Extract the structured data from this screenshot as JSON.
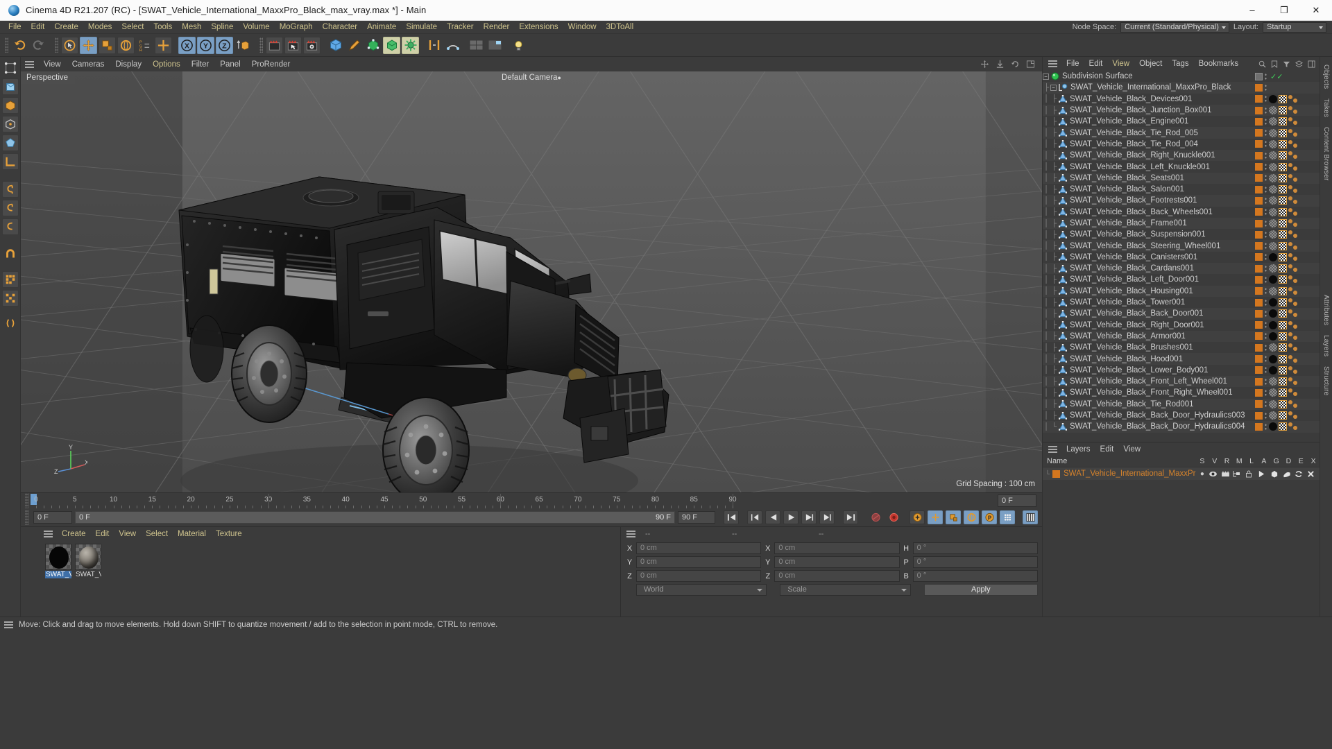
{
  "window": {
    "title": "Cinema 4D R21.207 (RC) - [SWAT_Vehicle_International_MaxxPro_Black_max_vray.max *] - Main",
    "minimize": "–",
    "maximize": "❐",
    "close": "✕"
  },
  "menubar": {
    "items": [
      "File",
      "Edit",
      "Create",
      "Modes",
      "Select",
      "Tools",
      "Mesh",
      "Spline",
      "Volume",
      "MoGraph",
      "Character",
      "Animate",
      "Simulate",
      "Tracker",
      "Render",
      "Extensions",
      "Window",
      "3DToAll"
    ],
    "node_space_label": "Node Space:",
    "node_space_value": "Current (Standard/Physical)",
    "layout_label": "Layout:",
    "layout_value": "Startup"
  },
  "viewport": {
    "menu": [
      "View",
      "Cameras",
      "Display",
      "Options",
      "Filter",
      "Panel",
      "ProRender"
    ],
    "active_menu": "Options",
    "view_name": "Perspective",
    "camera_label": "Default Camera",
    "grid_spacing": "Grid Spacing : 100 cm",
    "axis_x": "X",
    "axis_y": "Y",
    "axis_z": "Z"
  },
  "timeline": {
    "ticks": [
      0,
      5,
      10,
      15,
      20,
      25,
      30,
      35,
      40,
      45,
      50,
      55,
      60,
      65,
      70,
      75,
      80,
      85,
      90
    ],
    "current_frame": "0 F",
    "range_start": "0 F",
    "range_end": "90 F",
    "end_field": "90 F",
    "preview_field": "0 F"
  },
  "material_manager": {
    "menu": [
      "Create",
      "Edit",
      "View",
      "Select",
      "Material",
      "Texture"
    ],
    "materials": [
      {
        "name": "SWAT_V…",
        "type": "black",
        "selected": true
      },
      {
        "name": "SWAT_V…",
        "type": "texture",
        "selected": false
      }
    ]
  },
  "coordinates": {
    "header": [
      "--",
      "--",
      "--"
    ],
    "position": {
      "labels": [
        "X",
        "Y",
        "Z"
      ],
      "values": [
        "0 cm",
        "0 cm",
        "0 cm"
      ]
    },
    "size": {
      "labels": [
        "X",
        "Y",
        "Z"
      ],
      "values": [
        "0 cm",
        "0 cm",
        "0 cm"
      ]
    },
    "rotation": {
      "labels": [
        "H",
        "P",
        "B"
      ],
      "values": [
        "0 °",
        "0 °",
        "0 °"
      ]
    },
    "space_select": "World",
    "mode_select": "Scale",
    "apply_button": "Apply"
  },
  "object_manager": {
    "menu": [
      "File",
      "Edit",
      "View",
      "Object",
      "Tags",
      "Bookmarks"
    ],
    "active_menu": "View",
    "objects": [
      {
        "name": "Subdivision Surface",
        "icon": "subdivision-surface-icon",
        "depth": 0,
        "tags": "generator"
      },
      {
        "name": "SWAT_Vehicle_International_MaxxPro_Black",
        "icon": "null-object-icon",
        "depth": 1,
        "tags": "layer"
      },
      {
        "name": "SWAT_Vehicle_Black_Devices001",
        "icon": "polygon-object-icon",
        "depth": 2,
        "tags": "full"
      },
      {
        "name": "SWAT_Vehicle_Black_Junction_Box001",
        "icon": "polygon-object-icon",
        "depth": 2,
        "tags": "full-tex"
      },
      {
        "name": "SWAT_Vehicle_Black_Engine001",
        "icon": "polygon-object-icon",
        "depth": 2,
        "tags": "full-tex"
      },
      {
        "name": "SWAT_Vehicle_Black_Tie_Rod_005",
        "icon": "polygon-object-icon",
        "depth": 2,
        "tags": "full-tex"
      },
      {
        "name": "SWAT_Vehicle_Black_Tie_Rod_004",
        "icon": "polygon-object-icon",
        "depth": 2,
        "tags": "full-tex"
      },
      {
        "name": "SWAT_Vehicle_Black_Right_Knuckle001",
        "icon": "polygon-object-icon",
        "depth": 2,
        "tags": "full-tex"
      },
      {
        "name": "SWAT_Vehicle_Black_Left_Knuckle001",
        "icon": "polygon-object-icon",
        "depth": 2,
        "tags": "full-tex"
      },
      {
        "name": "SWAT_Vehicle_Black_Seats001",
        "icon": "polygon-object-icon",
        "depth": 2,
        "tags": "full-tex"
      },
      {
        "name": "SWAT_Vehicle_Black_Salon001",
        "icon": "polygon-object-icon",
        "depth": 2,
        "tags": "full-tex"
      },
      {
        "name": "SWAT_Vehicle_Black_Footrests001",
        "icon": "polygon-object-icon",
        "depth": 2,
        "tags": "full-tex"
      },
      {
        "name": "SWAT_Vehicle_Black_Back_Wheels001",
        "icon": "polygon-object-icon",
        "depth": 2,
        "tags": "full-tex"
      },
      {
        "name": "SWAT_Vehicle_Black_Frame001",
        "icon": "polygon-object-icon",
        "depth": 2,
        "tags": "full-tex"
      },
      {
        "name": "SWAT_Vehicle_Black_Suspension001",
        "icon": "polygon-object-icon",
        "depth": 2,
        "tags": "full-tex"
      },
      {
        "name": "SWAT_Vehicle_Black_Steering_Wheel001",
        "icon": "polygon-object-icon",
        "depth": 2,
        "tags": "full-tex"
      },
      {
        "name": "SWAT_Vehicle_Black_Canisters001",
        "icon": "polygon-object-icon",
        "depth": 2,
        "tags": "full"
      },
      {
        "name": "SWAT_Vehicle_Black_Cardans001",
        "icon": "polygon-object-icon",
        "depth": 2,
        "tags": "full-tex"
      },
      {
        "name": "SWAT_Vehicle_Black_Left_Door001",
        "icon": "polygon-object-icon",
        "depth": 2,
        "tags": "full"
      },
      {
        "name": "SWAT_Vehicle_Black_Housing001",
        "icon": "polygon-object-icon",
        "depth": 2,
        "tags": "full-tex"
      },
      {
        "name": "SWAT_Vehicle_Black_Tower001",
        "icon": "polygon-object-icon",
        "depth": 2,
        "tags": "full"
      },
      {
        "name": "SWAT_Vehicle_Black_Back_Door001",
        "icon": "polygon-object-icon",
        "depth": 2,
        "tags": "full"
      },
      {
        "name": "SWAT_Vehicle_Black_Right_Door001",
        "icon": "polygon-object-icon",
        "depth": 2,
        "tags": "full"
      },
      {
        "name": "SWAT_Vehicle_Black_Armor001",
        "icon": "polygon-object-icon",
        "depth": 2,
        "tags": "full"
      },
      {
        "name": "SWAT_Vehicle_Black_Brushes001",
        "icon": "polygon-object-icon",
        "depth": 2,
        "tags": "full-tex"
      },
      {
        "name": "SWAT_Vehicle_Black_Hood001",
        "icon": "polygon-object-icon",
        "depth": 2,
        "tags": "full"
      },
      {
        "name": "SWAT_Vehicle_Black_Lower_Body001",
        "icon": "polygon-object-icon",
        "depth": 2,
        "tags": "full"
      },
      {
        "name": "SWAT_Vehicle_Black_Front_Left_Wheel001",
        "icon": "polygon-object-icon",
        "depth": 2,
        "tags": "full-tex"
      },
      {
        "name": "SWAT_Vehicle_Black_Front_Right_Wheel001",
        "icon": "polygon-object-icon",
        "depth": 2,
        "tags": "full-tex"
      },
      {
        "name": "SWAT_Vehicle_Black_Tie_Rod001",
        "icon": "polygon-object-icon",
        "depth": 2,
        "tags": "full-tex"
      },
      {
        "name": "SWAT_Vehicle_Black_Back_Door_Hydraulics003",
        "icon": "polygon-object-icon",
        "depth": 2,
        "tags": "full-tex"
      },
      {
        "name": "SWAT_Vehicle_Black_Back_Door_Hydraulics004",
        "icon": "polygon-object-icon",
        "depth": 2,
        "tags": "full"
      }
    ]
  },
  "layer_manager": {
    "menu": [
      "Layers",
      "Edit",
      "View"
    ],
    "header_name": "Name",
    "columns": [
      "S",
      "V",
      "R",
      "M",
      "L",
      "A",
      "G",
      "D",
      "E",
      "X"
    ],
    "rows": [
      {
        "name": "SWAT_Vehicle_International_MaxxPro_Black",
        "color": "#d4822c"
      }
    ]
  },
  "side_tabs": [
    "Objects",
    "Takes",
    "Content Browser",
    "Attributes",
    "Layers",
    "Structure"
  ],
  "statusbar": {
    "message": "Move: Click and drag to move elements. Hold down SHIFT to quantize movement / add to the selection in point mode, CTRL to remove."
  },
  "colors": {
    "accent_blue": "#7a9fc4",
    "menu_text": "#cfc48e",
    "layer_orange": "#d4771f",
    "panel_bg": "#3b3b3b",
    "viewport_bg": "#5a5a5a"
  }
}
